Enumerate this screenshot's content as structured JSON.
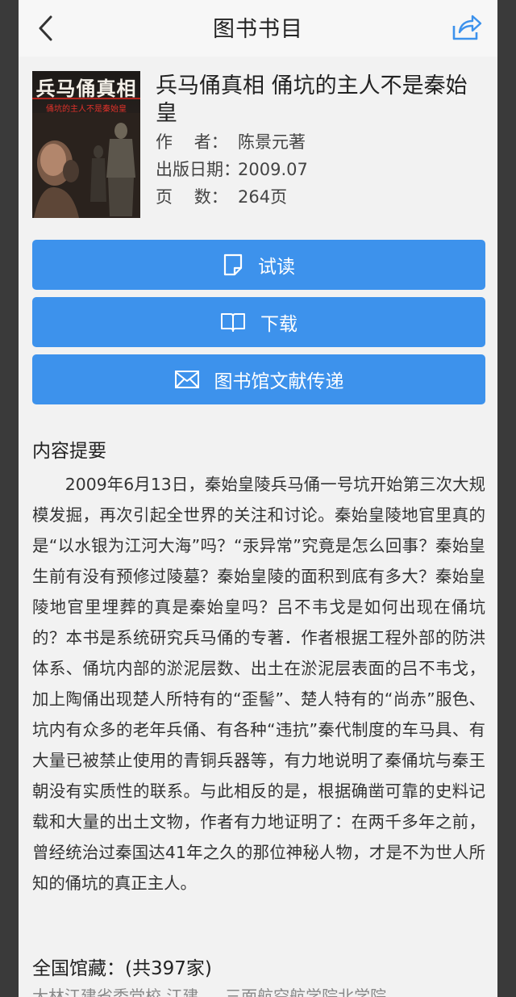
{
  "nav": {
    "title": "图书书目"
  },
  "book": {
    "cover_title": "兵马俑真相",
    "cover_subtitle": "俑坑的主人不是秦始皇",
    "title": "兵马俑真相 俑坑的主人不是秦始皇",
    "author_label": "作    者：",
    "author": "陈景元著",
    "date_label": "出版日期：",
    "date": "2009.07",
    "pages_label": "页    数：",
    "pages": "264页"
  },
  "actions": {
    "read_label": "试读",
    "download_label": "下载",
    "delivery_label": "图书馆文献传递"
  },
  "summary": {
    "heading": "内容提要",
    "text": "2009年6月13日，秦始皇陵兵马俑一号坑开始第三次大规模发掘，再次引起全世界的关注和讨论。秦始皇陵地官里真的是“以水银为江河大海”吗？“汞异常”究竟是怎么回事？秦始皇生前有没有预修过陵墓？秦始皇陵的面积到底有多大？秦始皇陵地官里埋葬的真是秦始皇吗？吕不韦戈是如何出现在俑坑的？本书是系统研究兵马俑的专著．作者根据工程外部的防洪体系、俑坑内部的淤泥层数、出土在淤泥层表面的吕不韦戈，加上陶俑出现楚人所特有的“歪髻”、楚人特有的“尚赤”服色、坑内有众多的老年兵俑、有各种“违抗”秦代制度的车马具、有大量已被禁止使用的青铜兵器等，有力地说明了秦俑坑与秦王朝没有实质性的联系。与此相反的是，根据确凿可靠的史料记载和大量的出土文物，作者有力地证明了：在两千多年之前，曾经统治过秦国达41年之久的那位神秘人物，才是不为世人所知的俑坑的真正主人。"
  },
  "holdings": {
    "heading": "全国馆藏：(共397家)",
    "partial_text": "大林江建省委党校 江建  …  三面航空航学院北学院"
  }
}
